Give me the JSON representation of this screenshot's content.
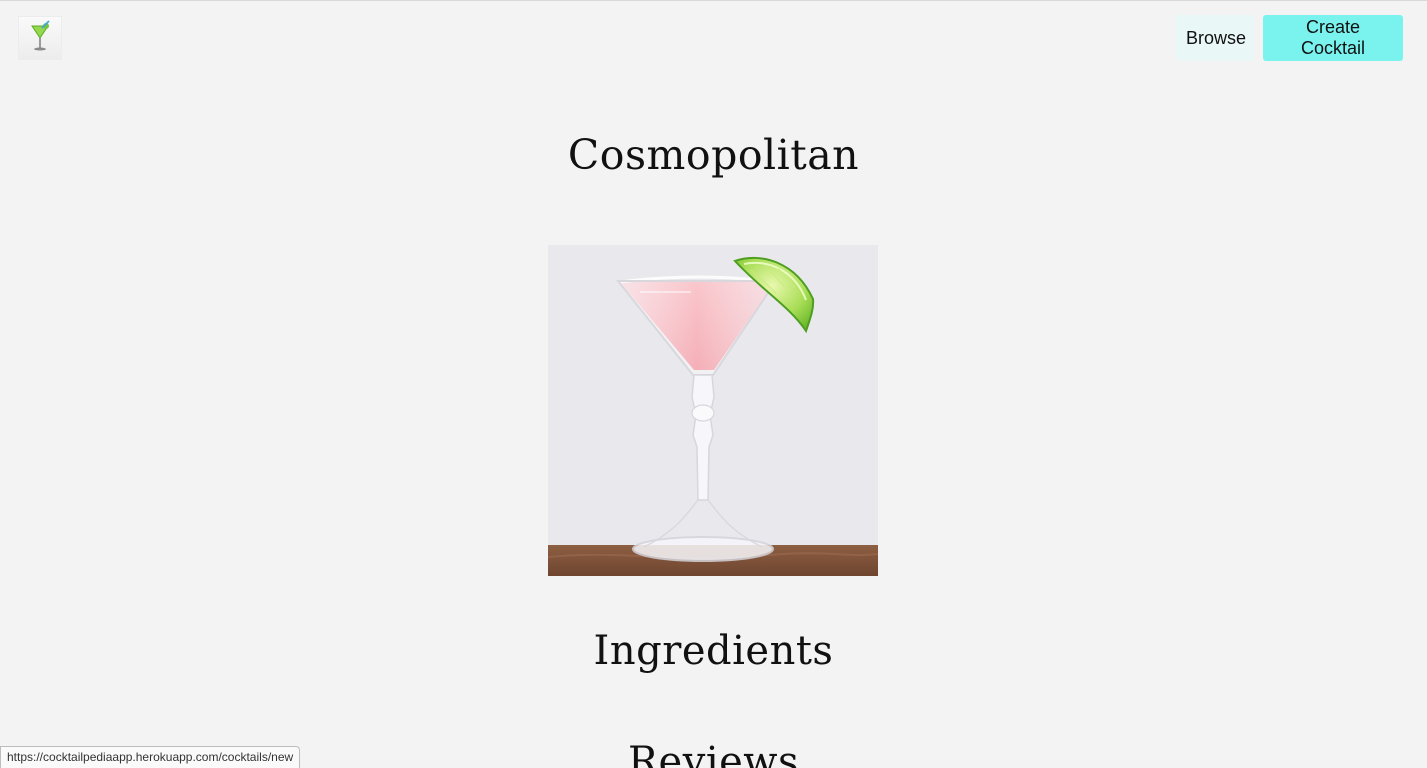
{
  "header": {
    "logo_icon": "cocktail-glass-icon",
    "browse_label": "Browse",
    "create_label": "Create Cocktail"
  },
  "main": {
    "title": "Cosmopolitan",
    "image_icon": "cosmopolitan-drink-image",
    "ingredients_heading": "Ingredients",
    "reviews_heading": "Reviews"
  },
  "status_bar": {
    "url": "https://cocktailpediaapp.herokuapp.com/cocktails/new"
  },
  "colors": {
    "background": "#f3f3f3",
    "browse_button": "#eaf7f7",
    "create_button": "#7af2ee",
    "drink_pink": "#f48b98",
    "lime": "#8ccf3f"
  }
}
